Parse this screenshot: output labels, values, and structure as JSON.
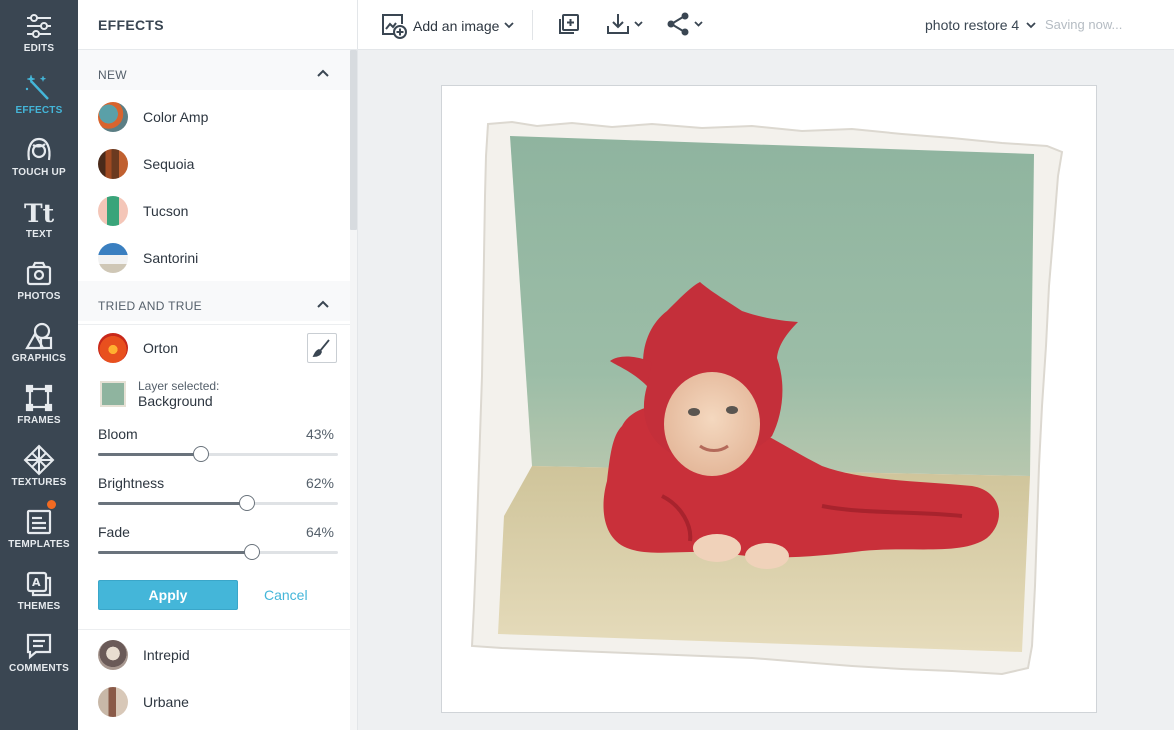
{
  "rail": {
    "items": [
      {
        "label": "EDITS",
        "icon": "sliders-icon"
      },
      {
        "label": "EFFECTS",
        "icon": "magic-wand-icon",
        "active": true
      },
      {
        "label": "TOUCH UP",
        "icon": "face-icon"
      },
      {
        "label": "TEXT",
        "icon": "text-icon"
      },
      {
        "label": "PHOTOS",
        "icon": "photos-icon"
      },
      {
        "label": "GRAPHICS",
        "icon": "graphics-icon"
      },
      {
        "label": "FRAMES",
        "icon": "frame-icon"
      },
      {
        "label": "TEXTURES",
        "icon": "texture-icon"
      },
      {
        "label": "TEMPLATES",
        "icon": "template-icon",
        "badge": true
      },
      {
        "label": "THEMES",
        "icon": "theme-icon"
      },
      {
        "label": "COMMENTS",
        "icon": "comment-icon"
      }
    ]
  },
  "panel": {
    "title": "EFFECTS",
    "new_section": {
      "title": "NEW",
      "items": [
        {
          "name": "Color Amp"
        },
        {
          "name": "Sequoia"
        },
        {
          "name": "Tucson"
        },
        {
          "name": "Santorini"
        }
      ]
    },
    "tried_section": {
      "title": "TRIED AND TRUE",
      "selected": {
        "name": "Orton",
        "layer_label": "Layer selected:",
        "layer_value": "Background",
        "sliders": [
          {
            "name": "Bloom",
            "value": "43%",
            "fraction": 0.43
          },
          {
            "name": "Brightness",
            "value": "62%",
            "fraction": 0.62
          },
          {
            "name": "Fade",
            "value": "64%",
            "fraction": 0.64
          }
        ],
        "apply_label": "Apply",
        "cancel_label": "Cancel"
      },
      "items": [
        {
          "name": "Intrepid"
        },
        {
          "name": "Urbane"
        }
      ]
    }
  },
  "topbar": {
    "add_image_label": "Add an image",
    "project_name": "photo restore 4",
    "status": "Saving now..."
  },
  "colors": {
    "accent": "#44b6d9",
    "rail_bg": "#3a4652",
    "badge": "#f26a21",
    "photo_backdrop": "#8fb49f",
    "outfit_red": "#c9303a"
  }
}
